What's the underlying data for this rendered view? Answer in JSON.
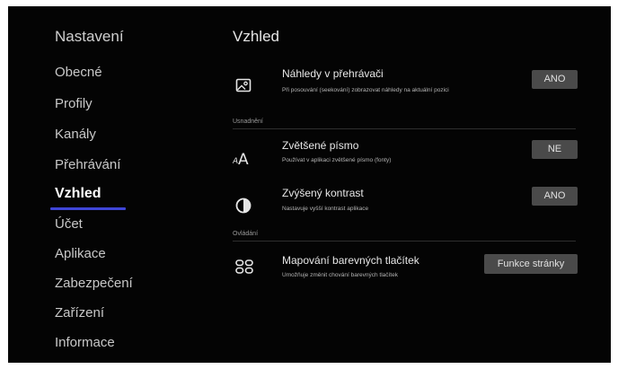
{
  "sidebar": {
    "title": "Nastavení",
    "items": [
      {
        "label": "Obecné"
      },
      {
        "label": "Profily"
      },
      {
        "label": "Kanály"
      },
      {
        "label": "Přehrávání"
      },
      {
        "label": "Vzhled",
        "active": true
      },
      {
        "label": "Účet"
      },
      {
        "label": "Aplikace"
      },
      {
        "label": "Zabezpečení"
      },
      {
        "label": "Zařízení"
      },
      {
        "label": "Informace"
      }
    ]
  },
  "main": {
    "title": "Vzhled",
    "sections": {
      "accessibility_label": "Usnadnění",
      "controls_label": "Ovládání"
    },
    "settings": [
      {
        "icon": "image-icon",
        "title": "Náhledy v přehrávači",
        "description": "Při posouvání (seekování) zobrazovat náhledy na aktuální pozici",
        "value": "ANO"
      },
      {
        "icon": "font-size-icon",
        "title": "Zvětšené písmo",
        "description": "Používat v aplikaci zvětšené písmo (fonty)",
        "value": "NE"
      },
      {
        "icon": "contrast-icon",
        "title": "Zvýšený kontrast",
        "description": "Nastavuje vyšší kontrast aplikace",
        "value": "ANO"
      },
      {
        "icon": "grid-buttons-icon",
        "title": "Mapování barevných tlačítek",
        "description": "Umožňuje změnit chování barevných tlačítek",
        "value": "Funkce stránky"
      }
    ]
  },
  "colors": {
    "background": "#040404",
    "active_underline": "#3f46d8",
    "button_background": "#4a4a4a"
  }
}
